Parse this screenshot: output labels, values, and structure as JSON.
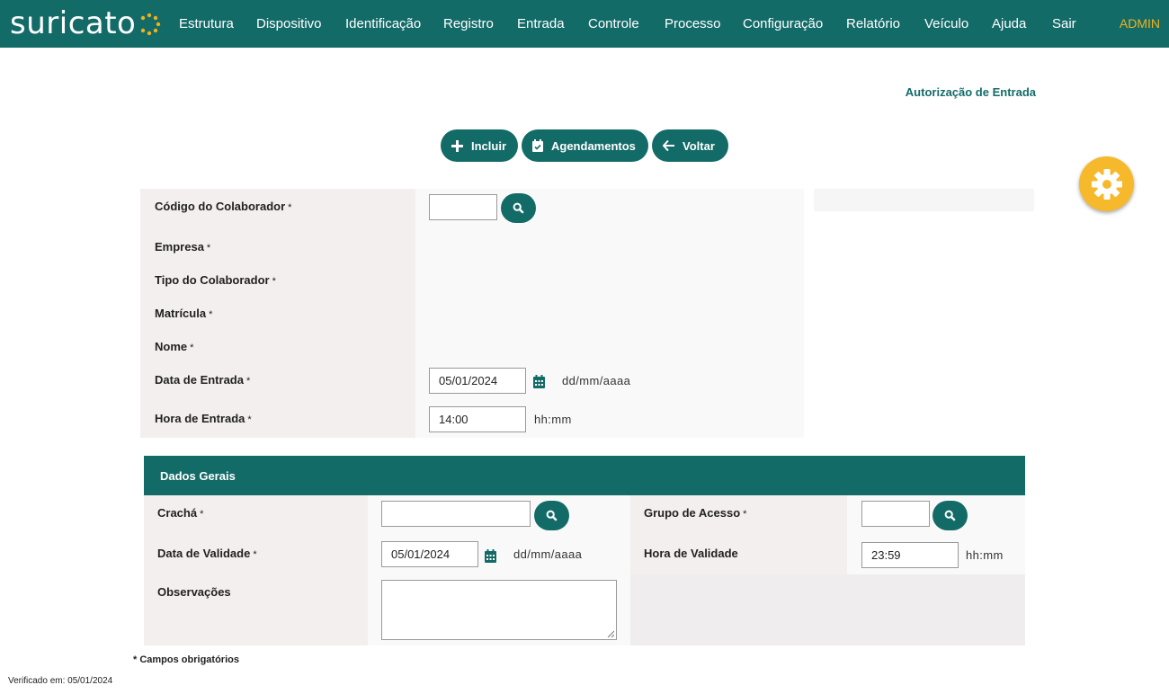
{
  "brand": {
    "logo_text": "suricato",
    "logo_dot_color": "#f1b21d"
  },
  "colors": {
    "primary": "#136b68",
    "accent": "#f1b21d",
    "gear": "#f7b92c"
  },
  "nav": {
    "items": [
      "Estrutura",
      "Dispositivo",
      "Identificação",
      "Registro",
      "Entrada",
      "Controle",
      "Processo",
      "Configuração",
      "Relatório",
      "Veículo",
      "Ajuda",
      "Sair"
    ],
    "user": "ADMIN"
  },
  "page": {
    "title": "Autorização de Entrada"
  },
  "actions": {
    "incluir": {
      "label": "Incluir",
      "icon": "plus-icon"
    },
    "agendamentos": {
      "label": "Agendamentos",
      "icon": "calendar-check-icon"
    },
    "voltar": {
      "label": "Voltar",
      "icon": "arrow-left-icon"
    }
  },
  "settings_button": {
    "icon": "gear-icon"
  },
  "form": {
    "codigo_colaborador": {
      "label": "Código do Colaborador",
      "value": ""
    },
    "empresa": {
      "label": "Empresa"
    },
    "tipo_colaborador": {
      "label": "Tipo do Colaborador"
    },
    "matricula": {
      "label": "Matrícula"
    },
    "nome": {
      "label": "Nome"
    },
    "data_entrada": {
      "label": "Data de Entrada",
      "value": "05/01/2024",
      "hint": "dd/mm/aaaa"
    },
    "hora_entrada": {
      "label": "Hora de Entrada",
      "value": "14:00",
      "hint": "hh:mm"
    },
    "required_mark": "*"
  },
  "dados_gerais": {
    "title": "Dados Gerais",
    "cracha": {
      "label": "Crachá",
      "value": ""
    },
    "grupo_acesso": {
      "label": "Grupo de Acesso",
      "value": ""
    },
    "data_validade": {
      "label": "Data de Validade",
      "value": "05/01/2024",
      "hint": "dd/mm/aaaa"
    },
    "hora_validade": {
      "label": "Hora de Validade",
      "value": "23:59",
      "hint": "hh:mm"
    },
    "observacoes": {
      "label": "Observações",
      "value": ""
    }
  },
  "footer": {
    "required_note": "* Campos obrigatórios",
    "verified": "Verificado em: 05/01/2024"
  }
}
